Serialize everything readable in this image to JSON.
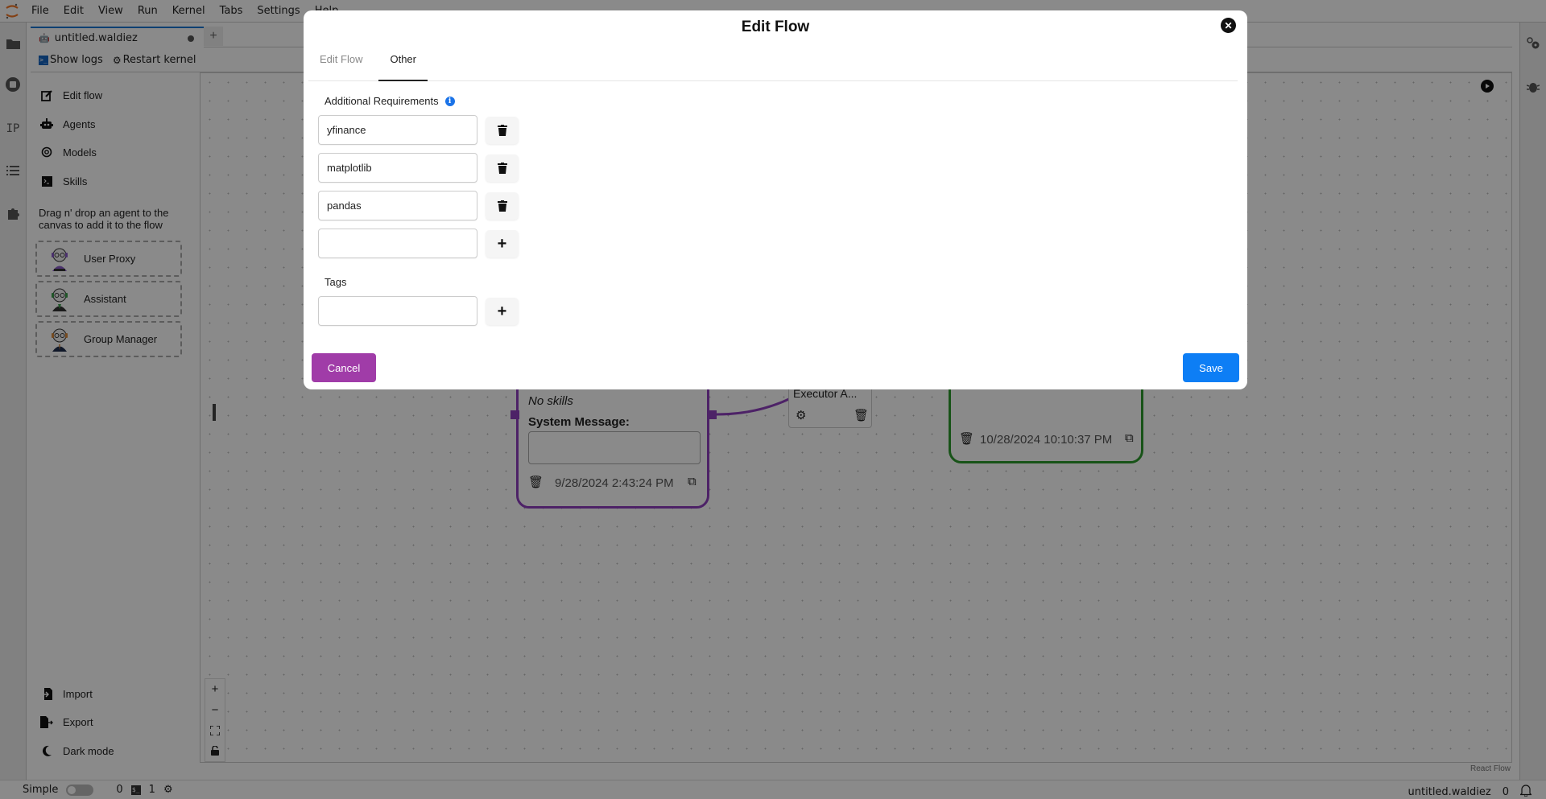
{
  "menubar": {
    "items": [
      "File",
      "Edit",
      "View",
      "Run",
      "Kernel",
      "Tabs",
      "Settings",
      "Help"
    ]
  },
  "tabs": {
    "active_tab": "untitled.waldiez",
    "add_label": "+"
  },
  "toolbar": {
    "show_logs": "Show logs",
    "restart_kernel": "Restart kernel"
  },
  "left_rail": {
    "icons": [
      "folder-icon",
      "stop-circle-icon",
      "ip-icon",
      "list-icon",
      "puzzle-icon"
    ],
    "ip_label": "IP"
  },
  "sidebar": {
    "items": [
      {
        "label": "Edit flow",
        "icon": "edit-icon"
      },
      {
        "label": "Agents",
        "icon": "robot-icon"
      },
      {
        "label": "Models",
        "icon": "openai-icon"
      },
      {
        "label": "Skills",
        "icon": "terminal-icon"
      }
    ],
    "hint": "Drag n' drop an agent to the canvas to add it to the flow",
    "agents": [
      {
        "label": "User Proxy",
        "accent": "#8a5cc7"
      },
      {
        "label": "Assistant",
        "accent": "#3b9e4a"
      },
      {
        "label": "Group Manager",
        "accent": "#d88a3c"
      }
    ],
    "bottom": [
      {
        "label": "Import",
        "icon": "file-import-icon"
      },
      {
        "label": "Export",
        "icon": "file-export-icon"
      },
      {
        "label": "Dark mode",
        "icon": "moon-icon"
      }
    ]
  },
  "canvas": {
    "zoom_controls": [
      "+",
      "−",
      "⛶",
      "🔓"
    ],
    "attribution": "React Flow",
    "nodes": {
      "purple": {
        "skills_text": "No skills",
        "system_message_label": "System Message:",
        "timestamp": "9/28/2024 2:43:24 PM",
        "color": "#8e3fbf"
      },
      "executor": {
        "label": "Executor A..."
      },
      "green": {
        "timestamp": "10/28/2024 10:10:37 PM",
        "color": "#2e9a2e"
      }
    }
  },
  "statusbar": {
    "mode_label": "Simple",
    "count_a": "0",
    "count_b": "1",
    "filename": "untitled.waldiez",
    "notifications": "0"
  },
  "modal": {
    "title": "Edit Flow",
    "tabs": [
      {
        "label": "Edit Flow",
        "active": false
      },
      {
        "label": "Other",
        "active": true
      }
    ],
    "requirements_label": "Additional Requirements",
    "requirements": [
      "yfinance",
      "matplotlib",
      "pandas"
    ],
    "new_requirement_value": "",
    "tags_label": "Tags",
    "new_tag_value": "",
    "cancel_label": "Cancel",
    "save_label": "Save",
    "colors": {
      "cancel": "#a03ca8",
      "save": "#0d7ef5",
      "info": "#1a73e8"
    }
  }
}
